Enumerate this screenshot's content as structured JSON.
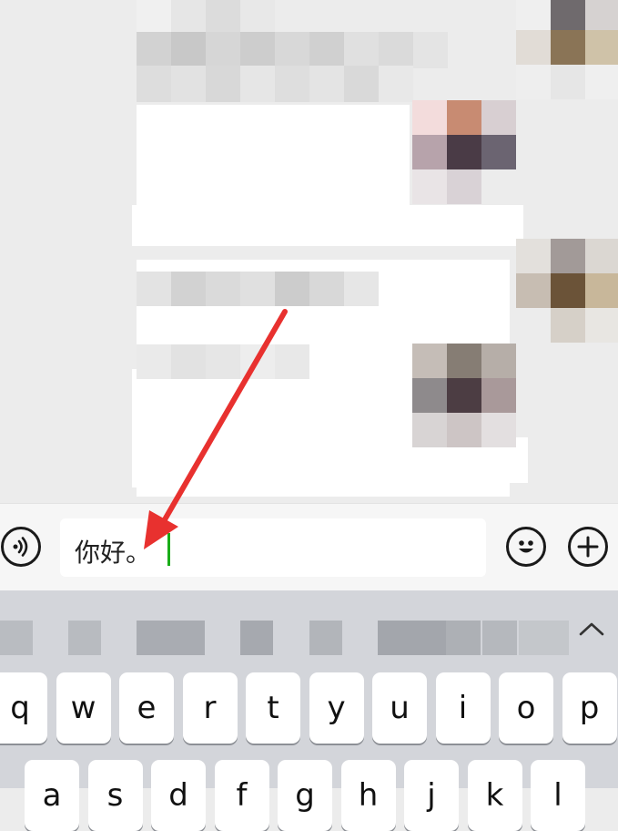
{
  "input": {
    "text": "你好。",
    "caret_color": "#1aad19"
  },
  "icons": {
    "voice": "voice-wave-icon",
    "emoji": "smiley-face-icon",
    "plus": "plus-circle-icon",
    "collapse": "chevron-up-icon"
  },
  "keyboard": {
    "row1": [
      "q",
      "w",
      "e",
      "r",
      "t",
      "y",
      "u",
      "i",
      "o",
      "p"
    ],
    "row2": [
      "a",
      "s",
      "d",
      "f",
      "g",
      "h",
      "j",
      "k",
      "l"
    ]
  },
  "colors": {
    "chat_background": "#ececec",
    "keyboard_background": "#d3d5da",
    "annotation_arrow": "#e8312f"
  }
}
